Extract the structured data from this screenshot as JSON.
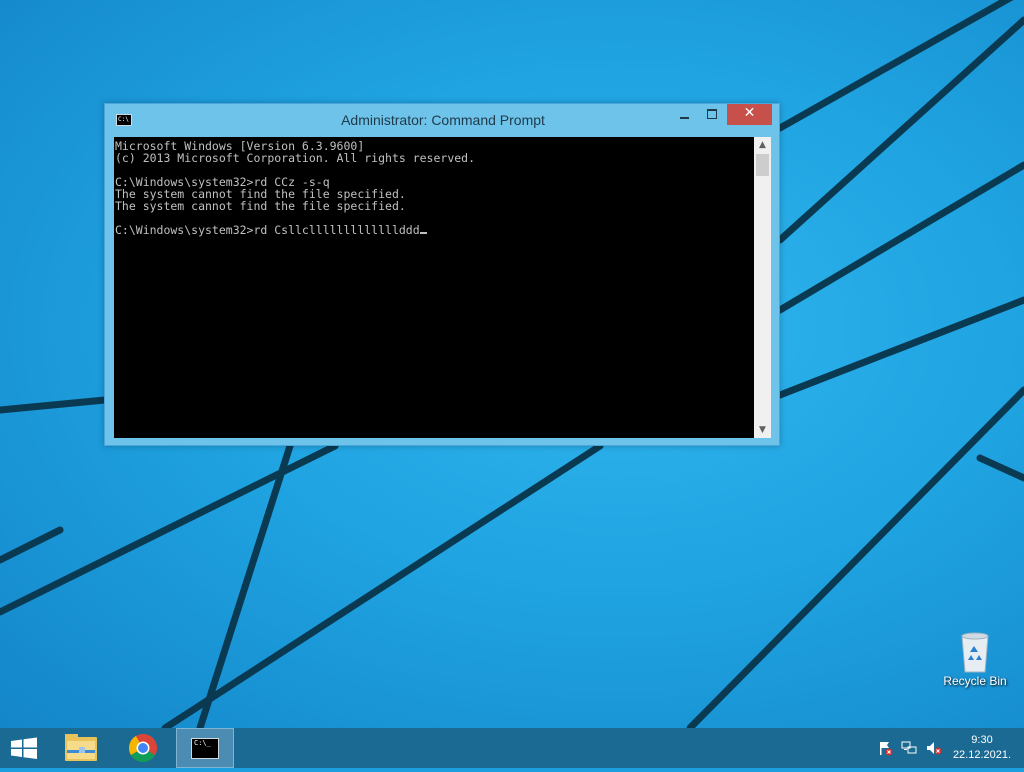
{
  "window": {
    "title": "Administrator: Command Prompt",
    "app_icon_text": "C:\\",
    "console_text": "Microsoft Windows [Version 6.3.9600]\n(c) 2013 Microsoft Corporation. All rights reserved.\n\nC:\\Windows\\system32>rd CCz -s-q\nThe system cannot find the file specified.\nThe system cannot find the file specified.\n\nC:\\Windows\\system32>rd Csllclllllllllllllddd",
    "close_label": "✕",
    "scroll_up": "▲",
    "scroll_down": "▼"
  },
  "desktop": {
    "recycle_bin_label": "Recycle Bin"
  },
  "taskbar": {
    "cmd_icon_text": "C:\\_",
    "clock_time": "9:30",
    "clock_date": "22.12.2021."
  },
  "colors": {
    "desktop_bg": "#1b9fdf",
    "taskbar_bg": "#1a6a93",
    "window_frame": "#6ec3ea",
    "close_button": "#c7504a",
    "console_bg": "#000000",
    "console_fg": "#c0c0c0"
  },
  "icons": {
    "start": "windows-logo-icon",
    "explorer": "file-explorer-icon",
    "chrome": "chrome-icon",
    "cmd": "command-prompt-icon",
    "tray_flag": "action-center-flag-icon",
    "tray_network": "network-icon",
    "tray_volume": "volume-muted-icon"
  }
}
